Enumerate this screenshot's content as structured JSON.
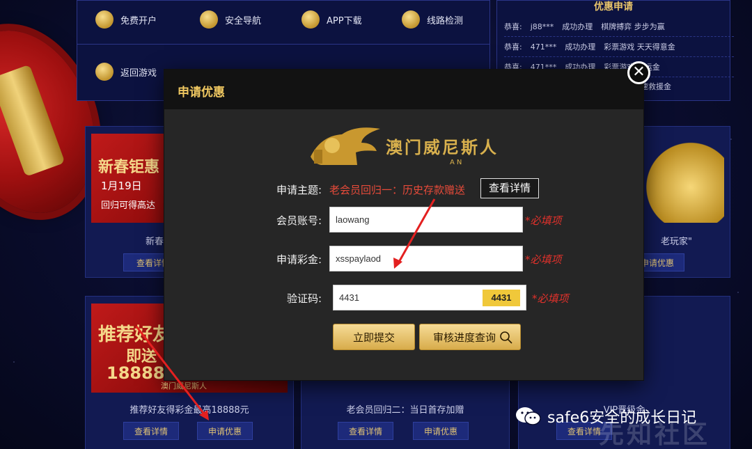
{
  "nav": {
    "items": [
      {
        "label": "免费开户",
        "icon": "user-plus-icon"
      },
      {
        "label": "安全导航",
        "icon": "rocket-icon"
      },
      {
        "label": "APP下载",
        "icon": "download-icon"
      },
      {
        "label": "线路检测",
        "icon": "route-icon"
      },
      {
        "label": "返回游戏",
        "icon": "gamepad-icon"
      }
    ]
  },
  "notice": {
    "title": "优惠申请",
    "rows": [
      {
        "prefix": "恭喜:",
        "user": "j88***",
        "status": "成功办理",
        "promo": "棋牌搏弈 步步为赢"
      },
      {
        "prefix": "恭喜:",
        "user": "471***",
        "status": "成功办理",
        "promo": "彩票游戏 天天得意金"
      },
      {
        "prefix": "恭喜:",
        "user": "471***",
        "status": "成功办理",
        "promo": "彩票游戏 转运金"
      },
      {
        "prefix": "",
        "user": "",
        "status": "",
        "promo": "速救援金"
      }
    ]
  },
  "cards": [
    {
      "banner_big": "新春钜惠",
      "banner_date": "1月19日",
      "banner_sub": "回归可得高达",
      "title": "新春",
      "detail_label": "查看详情"
    },
    {
      "title": "老玩家\"",
      "apply_label": "申请优惠"
    },
    {
      "banner_big": "推荐好友",
      "banner_sub": "即送",
      "banner_amount": "18888",
      "banner_brand": "澳门威尼斯人",
      "title": "推荐好友得彩金最高18888元",
      "detail_label": "查看详情",
      "apply_label": "申请优惠"
    },
    {
      "title": "老会员回归二：当日首存加赠",
      "detail_label": "查看详情",
      "apply_label": "申请优惠"
    },
    {
      "title": "VIP晋级金",
      "detail_label": "查看详情"
    }
  ],
  "modal": {
    "title": "申请优惠",
    "logo_text": "澳门威尼斯人",
    "logo_sub": "AN",
    "theme_label": "申请主题:",
    "theme_value": "老会员回归一：历史存款赠送",
    "detail_button": "查看详情",
    "account_label": "会员账号:",
    "account_value": "laowang",
    "bonus_label": "申请彩金:",
    "bonus_value": "xsspaylaod",
    "captcha_label": "验证码:",
    "captcha_value": "4431",
    "captcha_image_text": "4431",
    "required_text": "*必填项",
    "submit_button": "立即提交",
    "query_button": "审核进度查询",
    "close_glyph": "✕"
  },
  "watermark": {
    "text": "safe6安全的成长日记",
    "site": "先知社区"
  },
  "colors": {
    "gold": "#f0c861",
    "required": "#e0312b",
    "theme_red": "#e84b3a",
    "navy": "#0c1240"
  }
}
